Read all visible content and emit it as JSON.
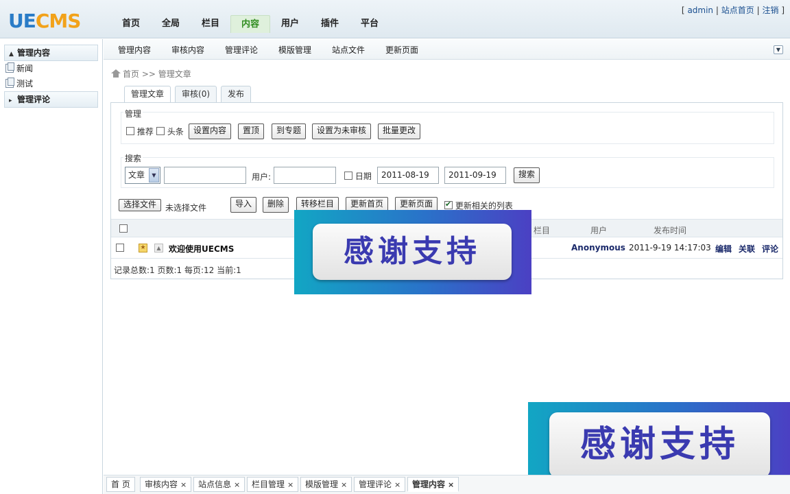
{
  "logo": {
    "ue": "UE",
    "cms": "CMS"
  },
  "topnav": [
    "首页",
    "全局",
    "栏目",
    "内容",
    "用户",
    "插件",
    "平台"
  ],
  "toplinks": {
    "open": "[",
    "user": "admin",
    "sep1": "|",
    "site_home": "站点首页",
    "sep2": "|",
    "logout": "注销",
    "close": "]"
  },
  "sidebar": {
    "group1": "管理内容",
    "items": [
      "新闻",
      "测试"
    ],
    "group2": "管理评论"
  },
  "subnav": [
    "管理内容",
    "审核内容",
    "管理评论",
    "模版管理",
    "站点文件",
    "更新页面"
  ],
  "breadcrumb": {
    "home": "首页",
    "sep": ">>",
    "current": "管理文章"
  },
  "tabs": [
    "管理文章",
    "审核(0)",
    "发布"
  ],
  "manage": {
    "legend": "管理",
    "recommend": "推荐",
    "headline": "头条",
    "buttons": [
      "设置内容",
      "置顶",
      "到专题",
      "设置为未审核",
      "批量更改"
    ]
  },
  "search": {
    "legend": "搜索",
    "type": "文章",
    "keyword": "",
    "user_label": "用户:",
    "user_value": "",
    "date_label": "日期",
    "date_from": "2011-08-19",
    "date_to": "2011-09-19",
    "button": "搜索"
  },
  "actions": {
    "choose_file": "选择文件",
    "no_file": "未选择文件",
    "buttons": [
      "导入",
      "删除",
      "转移栏目",
      "更新首页",
      "更新页面"
    ],
    "update_related": "更新相关的列表"
  },
  "table": {
    "headers": {
      "column": "栏目",
      "user": "用户",
      "time": "发布时间"
    },
    "rows": [
      {
        "title": "欢迎使用UECMS",
        "user": "Anonymous",
        "time": "2011-9-19 14:17:03",
        "edit": "编辑",
        "link": "关联",
        "comment": "评论"
      }
    ],
    "stats": "记录总数:1 页数:1 每页:12 当前:1"
  },
  "banner_text": "感谢支持",
  "bottom_tabs": [
    "首 页",
    "审核内容",
    "站点信息",
    "栏目管理",
    "模版管理",
    "管理评论",
    "管理内容"
  ],
  "colors": {
    "accent": "#2f8c1f",
    "brand_blue": "#2a7cc7",
    "brand_orange": "#f2a21a"
  }
}
